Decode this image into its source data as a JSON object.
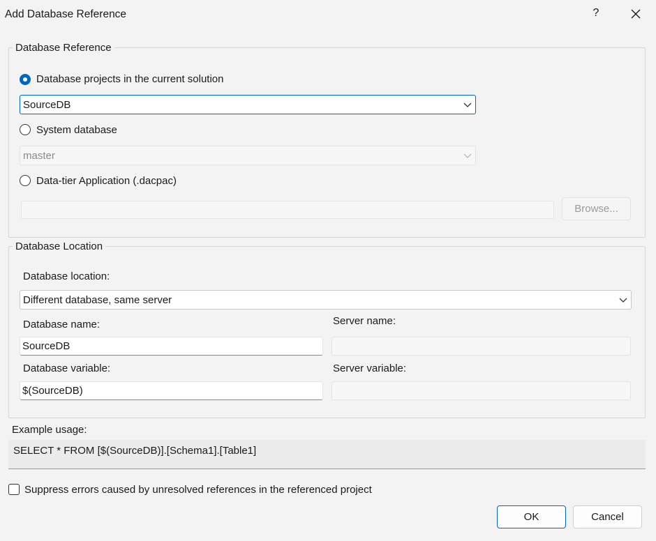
{
  "window": {
    "title": "Add Database Reference",
    "help_glyph": "?"
  },
  "reference_group": {
    "label": "Database Reference",
    "option_projects": {
      "label": "Database projects in the current solution",
      "selected": true
    },
    "projects_combo_value": "SourceDB",
    "option_system": {
      "label": "System database",
      "selected": false
    },
    "system_combo_value": "master",
    "option_dacpac": {
      "label": "Data-tier Application (.dacpac)",
      "selected": false
    },
    "dacpac_path": "",
    "browse_label": "Browse..."
  },
  "location_group": {
    "label": "Database Location",
    "location_label": "Database location:",
    "location_value": "Different database, same server",
    "db_name_label": "Database name:",
    "db_name_value": "SourceDB",
    "server_name_label": "Server name:",
    "server_name_value": "",
    "db_variable_label": "Database variable:",
    "db_variable_value": "$(SourceDB)",
    "server_variable_label": "Server variable:",
    "server_variable_value": ""
  },
  "example": {
    "label": "Example usage:",
    "text": "SELECT * FROM [$(SourceDB)].[Schema1].[Table1]"
  },
  "suppress": {
    "label": "Suppress errors caused by unresolved references in the referenced project",
    "checked": false
  },
  "buttons": {
    "ok": "OK",
    "cancel": "Cancel"
  },
  "colors": {
    "accent": "#0067c0",
    "background": "#f3f3f3"
  },
  "icons": {
    "close": "close-icon",
    "dropdown": "chevron-down-icon"
  }
}
